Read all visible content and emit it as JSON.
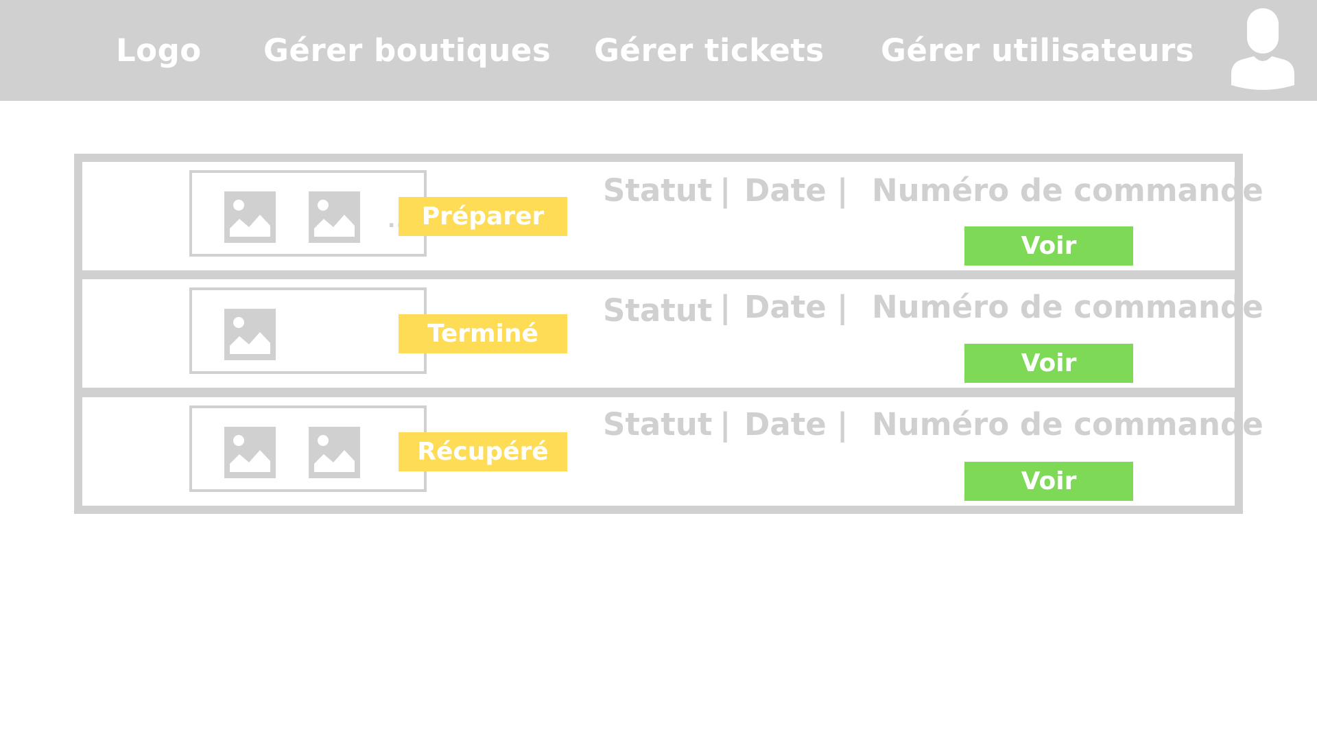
{
  "header": {
    "logo": "Logo",
    "nav": [
      {
        "label": "Gérer boutiques"
      },
      {
        "label": "Gérer tickets"
      },
      {
        "label": "Gérer utilisateurs"
      }
    ],
    "user_icon": "user-avatar-icon"
  },
  "orders": [
    {
      "images": 2,
      "has_more": true,
      "more_label": "...",
      "action_label": "Préparer",
      "status_label": "Statut",
      "date_label": "Date",
      "order_number_label": "Numéro de commande",
      "separator": "|",
      "view_label": "Voir"
    },
    {
      "images": 1,
      "has_more": false,
      "action_label": "Terminé",
      "status_label": "Statut",
      "date_label": "Date",
      "order_number_label": "Numéro de commande",
      "separator": "|",
      "view_label": "Voir"
    },
    {
      "images": 2,
      "has_more": false,
      "action_label": "Récupéré",
      "status_label": "Statut",
      "date_label": "Date",
      "order_number_label": "Numéro de commande",
      "separator": "|",
      "view_label": "Voir"
    }
  ],
  "colors": {
    "header_bg": "#d0d0d0",
    "border": "#d0d0d0",
    "status_badge": "#ffdc55",
    "view_button": "#7ed957",
    "text_light": "#ffffff",
    "text_muted": "#d0d0d0"
  }
}
